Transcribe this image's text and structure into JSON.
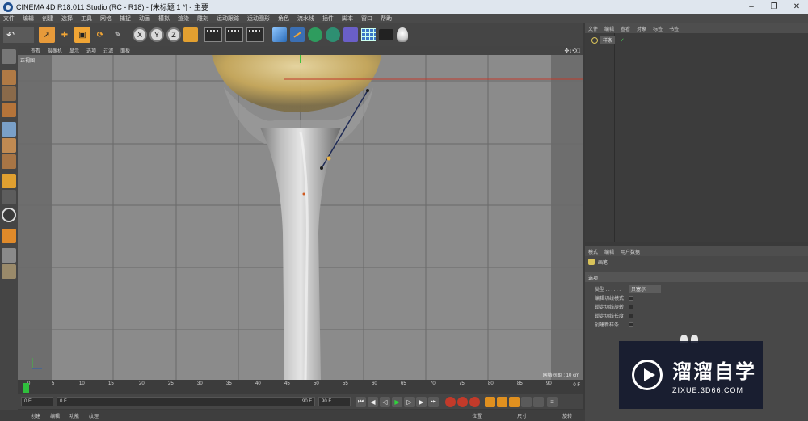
{
  "window": {
    "title": "CINEMA 4D R18.011 Studio (RC - R18) - [未标题 1 *] - 主要",
    "controls": [
      "–",
      "❐",
      "✕"
    ]
  },
  "menubar": [
    "文件",
    "编辑",
    "创建",
    "选择",
    "工具",
    "网格",
    "捕捉",
    "动画",
    "模拟",
    "渲染",
    "雕刻",
    "运动跟踪",
    "运动图形",
    "角色",
    "流水线",
    "插件",
    "脚本",
    "窗口",
    "帮助"
  ],
  "toolbar": {
    "axis_x": "X",
    "axis_y": "Y",
    "axis_z": "Z"
  },
  "viewport": {
    "menu": [
      "查看",
      "摄像机",
      "显示",
      "选项",
      "过滤",
      "面板"
    ],
    "label": "正视图",
    "grid_spacing": "网格间距 : 10 cm",
    "nav_icons": "✥↓⟲□"
  },
  "timeline": {
    "ticks": [
      "0",
      "5",
      "10",
      "15",
      "20",
      "25",
      "30",
      "35",
      "40",
      "45",
      "50",
      "55",
      "60",
      "65",
      "70",
      "75",
      "80",
      "85",
      "90"
    ],
    "current_frame": "0 F",
    "start_frame": "0 F",
    "end_frame_a": "90 F",
    "end_frame_b": "90 F",
    "end_label": "0 F"
  },
  "bottombar": {
    "left_items": [
      "创建",
      "编辑",
      "功能",
      "纹理"
    ],
    "right_items": [
      "位置",
      "尺寸",
      "旋转"
    ]
  },
  "object_manager": {
    "menu": [
      "文件",
      "编辑",
      "查看",
      "对象",
      "标签",
      "书签"
    ],
    "object_name": "样条"
  },
  "attribute_manager": {
    "menu": [
      "模式",
      "编辑",
      "用户数据"
    ],
    "tool_name": "画笔",
    "section": "选项",
    "type_label": "类型 . . . . . .",
    "type_value": "贝塞尔",
    "rows": [
      "编辑切线模式",
      "锁定切线旋转",
      "锁定切线长度",
      "创建新样条"
    ]
  },
  "watermark": {
    "brand": "溜溜自学",
    "url": "ZIXUE.3D66.COM"
  },
  "colors": {
    "accent_orange": "#f0a535",
    "playhead_green": "#2fbf3c",
    "axis_red": "#c0392b"
  }
}
